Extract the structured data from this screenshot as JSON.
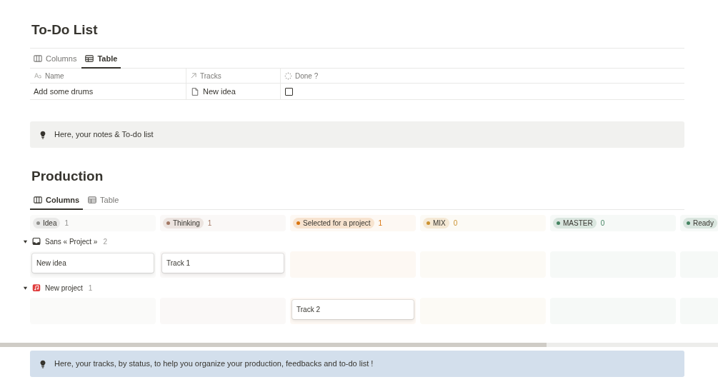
{
  "todo": {
    "title": "To-Do List",
    "tabs": [
      {
        "label": "Columns",
        "kind": "columns",
        "selected": false
      },
      {
        "label": "Table",
        "kind": "table",
        "selected": true
      }
    ],
    "columns": [
      {
        "label": "Name",
        "kind": "text"
      },
      {
        "label": "Tracks",
        "kind": "relation"
      },
      {
        "label": "Done ?",
        "kind": "status"
      }
    ],
    "rows": [
      {
        "name": "Add some drums",
        "track": "New idea",
        "done": false
      }
    ],
    "callout": "Here, your notes & To-do list"
  },
  "production": {
    "title": "Production",
    "tabs": [
      {
        "label": "Columns",
        "kind": "columns",
        "selected": true
      },
      {
        "label": "Table",
        "kind": "table",
        "selected": false
      }
    ],
    "statuses": [
      {
        "label": "Idea",
        "count": "1",
        "color": "#91918e"
      },
      {
        "label": "Thinking",
        "count": "1",
        "color": "#a27763"
      },
      {
        "label": "Selected for a project",
        "count": "1",
        "color": "#d9730d"
      },
      {
        "label": "MIX",
        "count": "0",
        "color": "#cb912f"
      },
      {
        "label": "MASTER",
        "count": "0",
        "color": "#448361"
      },
      {
        "label": "Ready",
        "color": "#448361"
      }
    ],
    "groups": [
      {
        "label": "Sans « Project »",
        "count": "2",
        "kind": "tray",
        "expanded": true,
        "cells": [
          [
            "New idea"
          ],
          [
            "Track 1"
          ],
          [],
          [],
          [],
          []
        ]
      },
      {
        "label": "New project",
        "count": "1",
        "kind": "music",
        "expanded": true,
        "cells": [
          [],
          [],
          [
            "Track 2"
          ],
          [],
          [],
          []
        ]
      }
    ],
    "callout": "Here, your tracks, by status, to help you organize your production, feedbacks and to-do list !"
  }
}
